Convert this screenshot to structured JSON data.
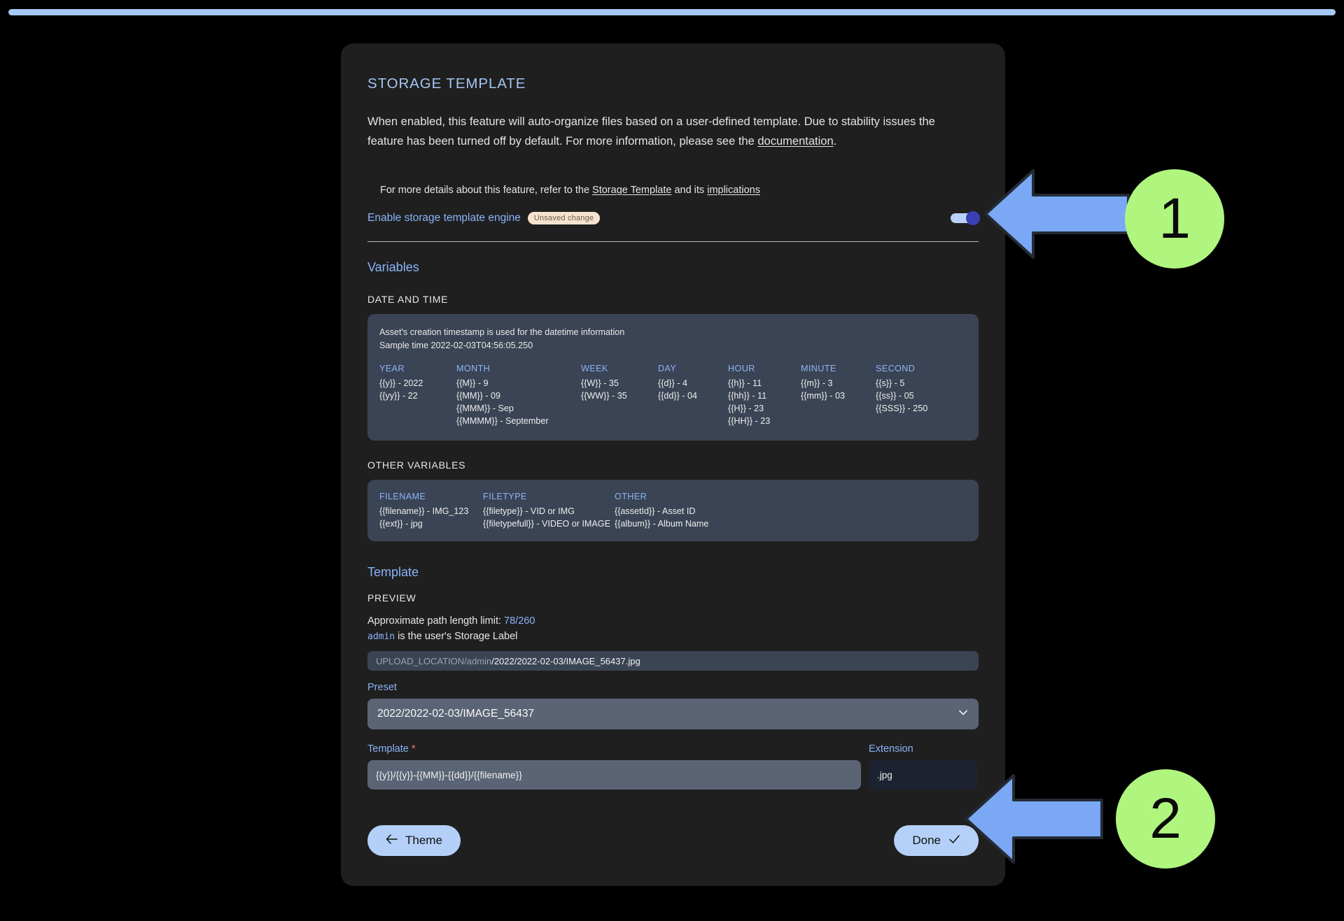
{
  "page": {
    "title": "STORAGE TEMPLATE",
    "description_part1": "When enabled, this feature will auto-organize files based on a user-defined template. Due to stability issues the feature has been turned off by default. For more information, please see the ",
    "description_link": "documentation",
    "description_part2": "."
  },
  "subnote": {
    "prefix": "For more details about this feature, refer to the ",
    "link1": "Storage Template",
    "middle": " and its ",
    "link2": "implications"
  },
  "toggle": {
    "label": "Enable storage template engine",
    "badge": "Unsaved change",
    "state": "on",
    "track_color": "#b9d3f8",
    "knob_color": "#3b3fb5"
  },
  "variables": {
    "heading": "Variables",
    "datetime_kicker": "DATE AND TIME",
    "panel_line1": "Asset's creation timestamp is used for the datetime information",
    "panel_line2": "Sample time 2022-02-03T04:56:05.250",
    "datetime_columns": [
      {
        "title": "YEAR",
        "items": [
          "{{y}} - 2022",
          "{{yy}} - 22"
        ]
      },
      {
        "title": "MONTH",
        "items": [
          "{{M}} - 9",
          "{{MM}} - 09",
          "{{MMM}} - Sep",
          "{{MMMM}} - September"
        ]
      },
      {
        "title": "WEEK",
        "items": [
          "{{W}} - 35",
          "{{WW}} - 35"
        ]
      },
      {
        "title": "DAY",
        "items": [
          "{{d}} - 4",
          "{{dd}} - 04"
        ]
      },
      {
        "title": "HOUR",
        "items": [
          "{{h}} - 11",
          "{{hh}} - 11",
          "{{H}} - 23",
          "{{HH}} - 23"
        ]
      },
      {
        "title": "MINUTE",
        "items": [
          "{{m}} - 3",
          "{{mm}} - 03"
        ]
      },
      {
        "title": "SECOND",
        "items": [
          "{{s}} - 5",
          "{{ss}} - 05",
          "{{SSS}} - 250"
        ]
      }
    ],
    "other_kicker": "OTHER VARIABLES",
    "other_columns": [
      {
        "title": "FILENAME",
        "items": [
          "{{filename}} - IMG_123",
          "{{ext}} - jpg"
        ]
      },
      {
        "title": "FILETYPE",
        "items": [
          "{{filetype}} - VID or IMG",
          "{{filetypefull}} - VIDEO or IMAGE"
        ]
      },
      {
        "title": "OTHER",
        "items": [
          "{{assetId}} - Asset ID",
          "{{album}} - Album Name"
        ]
      }
    ]
  },
  "template": {
    "heading": "Template",
    "preview_kicker": "PREVIEW",
    "path_limit_prefix": "Approximate path length limit: ",
    "path_limit_value": "78/260",
    "storage_label_code": "admin",
    "storage_label_text": " is the user's Storage Label",
    "preview_dim": "UPLOAD_LOCATION/admin",
    "preview_bright": "/2022/2022-02-03/IMAGE_56437.jpg",
    "preset_label": "Preset",
    "preset_value": "2022/2022-02-03/IMAGE_56437",
    "template_label": "Template",
    "template_required_mark": "*",
    "template_value": "{{y}}/{{y}}-{{MM}}-{{dd}}/{{filename}}",
    "extension_label": "Extension",
    "extension_value": ".jpg"
  },
  "footer": {
    "back_icon": "arrow-left-icon",
    "back_label": "Theme",
    "done_label": "Done",
    "done_icon": "check-icon"
  },
  "annotations": {
    "accent_arrow_color": "#7aa8f5",
    "badge_color": "#b0f57e",
    "items": [
      {
        "number": "1"
      },
      {
        "number": "2"
      }
    ]
  }
}
